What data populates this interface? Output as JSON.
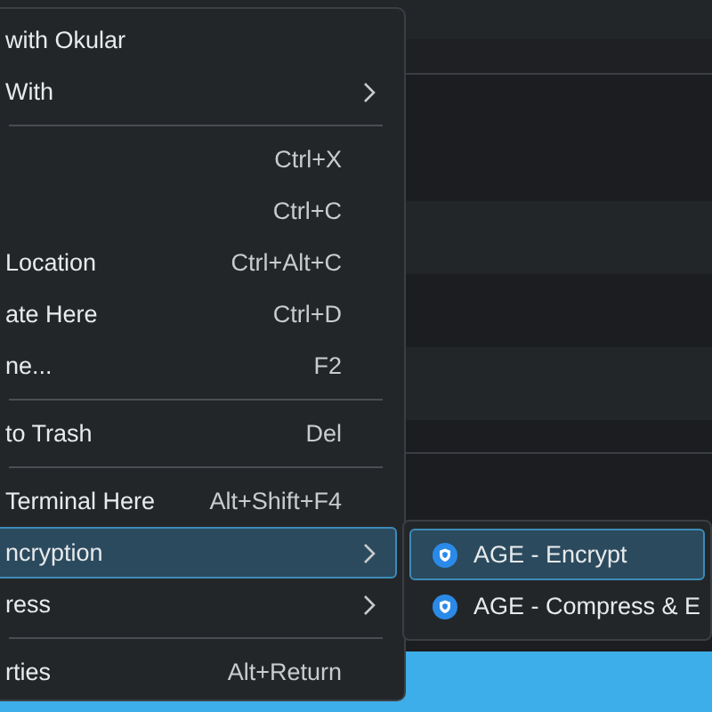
{
  "context_menu": {
    "items": [
      {
        "kind": "item",
        "label": "with Okular",
        "submenu": false,
        "selected": false
      },
      {
        "kind": "item",
        "label": "With",
        "submenu": true,
        "selected": false
      },
      {
        "kind": "separator"
      },
      {
        "kind": "item",
        "shortcut": "Ctrl+X",
        "submenu": false,
        "selected": false
      },
      {
        "kind": "item",
        "shortcut": "Ctrl+C",
        "submenu": false,
        "selected": false
      },
      {
        "kind": "item",
        "label": "Location",
        "shortcut": "Ctrl+Alt+C",
        "submenu": false,
        "selected": false
      },
      {
        "kind": "item",
        "label": "ate Here",
        "shortcut": "Ctrl+D",
        "submenu": false,
        "selected": false
      },
      {
        "kind": "item",
        "label": "ne...",
        "shortcut": "F2",
        "submenu": false,
        "selected": false
      },
      {
        "kind": "separator"
      },
      {
        "kind": "item",
        "label": "to Trash",
        "shortcut": "Del",
        "submenu": false,
        "selected": false
      },
      {
        "kind": "separator"
      },
      {
        "kind": "item",
        "label": "Terminal Here",
        "shortcut": "Alt+Shift+F4",
        "submenu": false,
        "selected": false
      },
      {
        "kind": "item",
        "label": "ncryption",
        "submenu": true,
        "selected": true
      },
      {
        "kind": "item",
        "label": "ress",
        "submenu": true,
        "selected": false
      },
      {
        "kind": "separator"
      },
      {
        "kind": "item",
        "label": "rties",
        "shortcut": "Alt+Return",
        "submenu": false,
        "selected": false
      }
    ]
  },
  "submenu": {
    "items": [
      {
        "label": "AGE - Encrypt",
        "selected": true
      },
      {
        "label": "AGE - Compress & E",
        "selected": false
      }
    ]
  }
}
